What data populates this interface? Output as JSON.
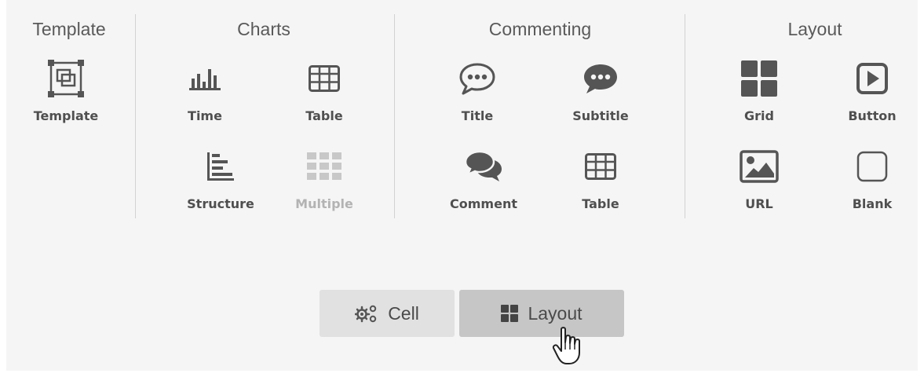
{
  "sections": {
    "template": {
      "title": "Template"
    },
    "charts": {
      "title": "Charts"
    },
    "commenting": {
      "title": "Commenting"
    },
    "layout": {
      "title": "Layout"
    }
  },
  "tools": {
    "template": {
      "label": "Template",
      "icon": "template-icon"
    },
    "time": {
      "label": "Time",
      "icon": "bar-chart-icon"
    },
    "charts_table": {
      "label": "Table",
      "icon": "table-icon"
    },
    "structure": {
      "label": "Structure",
      "icon": "horizontal-bar-chart-icon"
    },
    "multiple": {
      "label": "Multiple",
      "icon": "multiple-grid-icon",
      "disabled": true
    },
    "title": {
      "label": "Title",
      "icon": "speech-bubble-outline-icon"
    },
    "subtitle": {
      "label": "Subtitle",
      "icon": "speech-bubble-filled-icon"
    },
    "comment": {
      "label": "Comment",
      "icon": "comments-icon"
    },
    "commenting_table": {
      "label": "Table",
      "icon": "table-icon"
    },
    "grid": {
      "label": "Grid",
      "icon": "grid-icon"
    },
    "button": {
      "label": "Button",
      "icon": "play-button-icon"
    },
    "url": {
      "label": "URL",
      "icon": "image-icon"
    },
    "blank": {
      "label": "Blank",
      "icon": "blank-square-icon"
    }
  },
  "footer": {
    "cell_label": "Cell",
    "layout_label": "Layout",
    "active": "Layout"
  },
  "colors": {
    "panel_bg": "#f5f5f5",
    "icon": "#555555",
    "disabled": "#c8c8c8",
    "active_button": "#c6c6c6",
    "inactive_button": "#e1e1e1"
  }
}
